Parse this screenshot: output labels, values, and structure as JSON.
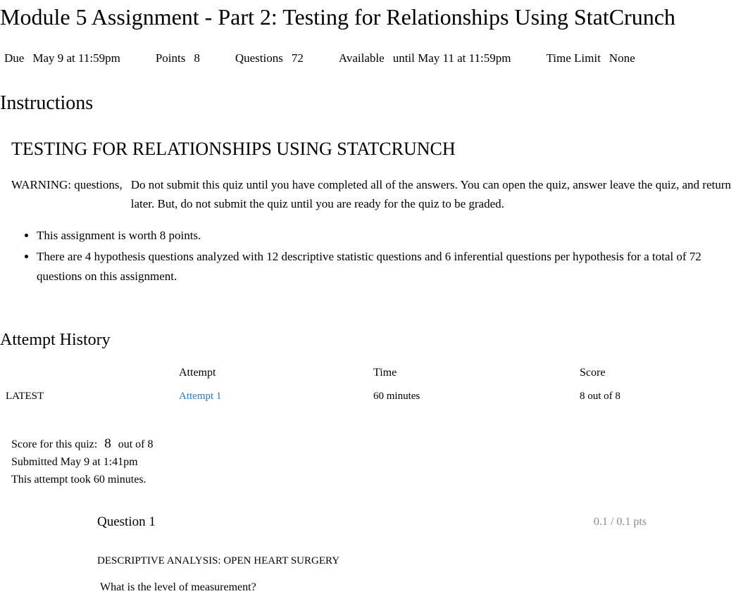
{
  "title": "Module 5 Assignment - Part 2: Testing for Relationships Using StatCrunch",
  "meta": {
    "due_label": "Due",
    "due_value": "May 9 at 11:59pm",
    "points_label": "Points",
    "points_value": "8",
    "questions_label": "Questions",
    "questions_value": "72",
    "available_label": "Available",
    "available_value": "until May 11 at 11:59pm",
    "timelimit_label": "Time Limit",
    "timelimit_value": "None"
  },
  "instructions": {
    "heading": "Instructions",
    "title": "TESTING FOR RELATIONSHIPS USING STATCRUNCH",
    "warning_label": "WARNING: questions,",
    "warning_text": "Do not submit this quiz until you have completed all of the answers. You can open the quiz, answer leave the quiz, and return later. But, do not submit the quiz until you are ready for the quiz to be graded.",
    "bullets": [
      "This assignment is worth 8 points.",
      "There are 4 hypothesis questions analyzed with 12 descriptive statistic questions and 6 inferential questions per hypothesis for a total of 72 questions on this assignment."
    ]
  },
  "attempt_history": {
    "heading": "Attempt History",
    "columns": {
      "status": "",
      "attempt": "Attempt",
      "time": "Time",
      "score": "Score"
    },
    "rows": [
      {
        "status": "LATEST",
        "attempt": "Attempt 1",
        "time": "60 minutes",
        "score": "8 out of 8"
      }
    ]
  },
  "score_summary": {
    "label": "Score for this quiz:",
    "earned": "8",
    "out_of": "out of 8",
    "submitted": "Submitted May 9 at 1:41pm",
    "duration": "This attempt took 60 minutes."
  },
  "question": {
    "label": "Question 1",
    "pts": "0.1 / 0.1 pts",
    "section": "DESCRIPTIVE ANALYSIS: OPEN HEART SURGERY",
    "prompt": "What is the level of measurement?"
  }
}
